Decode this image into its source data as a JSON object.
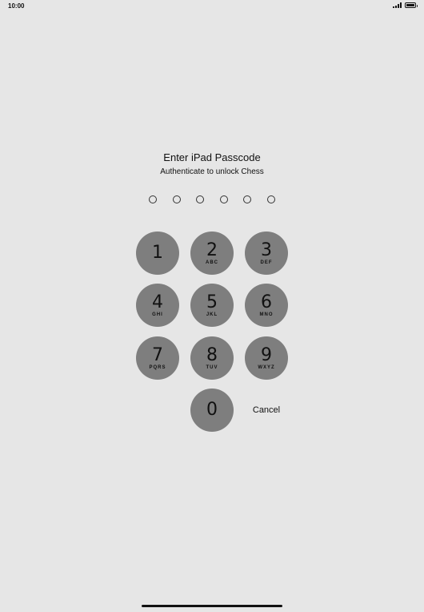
{
  "status_bar": {
    "time": "10:00",
    "signal_icon": "signal-bars-icon",
    "battery_icon": "battery-icon"
  },
  "prompt": {
    "title": "Enter iPad Passcode",
    "subtitle": "Authenticate to unlock Chess"
  },
  "passcode": {
    "length": 6,
    "entered": 0
  },
  "keypad": {
    "keys": [
      {
        "digit": "1",
        "letters": ""
      },
      {
        "digit": "2",
        "letters": "ABC"
      },
      {
        "digit": "3",
        "letters": "DEF"
      },
      {
        "digit": "4",
        "letters": "GHI"
      },
      {
        "digit": "5",
        "letters": "JKL"
      },
      {
        "digit": "6",
        "letters": "MNO"
      },
      {
        "digit": "7",
        "letters": "PQRS"
      },
      {
        "digit": "8",
        "letters": "TUV"
      },
      {
        "digit": "9",
        "letters": "WXYZ"
      },
      {
        "digit": "0",
        "letters": ""
      }
    ],
    "cancel_label": "Cancel"
  },
  "colors": {
    "background": "#e6e6e6",
    "key": "#7e7e7e",
    "text": "#111111"
  }
}
